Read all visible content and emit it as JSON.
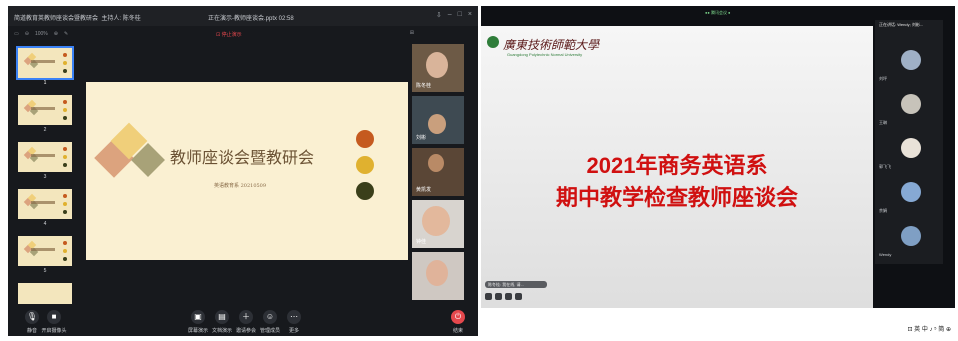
{
  "meeting": {
    "title": "简道教育英教师座谈会暨教研会",
    "host_label": "主持人: 陈冬桂",
    "presenting": "正在演示-教师座谈会.pptx 02:58",
    "stop_share": "停止演示",
    "zoom_level": "100%"
  },
  "thumbnails": [
    {
      "num": "1"
    },
    {
      "num": "2"
    },
    {
      "num": "3"
    },
    {
      "num": "4"
    },
    {
      "num": "5"
    }
  ],
  "slide": {
    "title": "教师座谈会暨教研会",
    "subtitle": "英语教育系 20210509",
    "colors": {
      "orange": "#c55a1f",
      "gold": "#e0b12f",
      "olive": "#3a3f1a",
      "tan": "#dca37e",
      "sand": "#f0cf7a",
      "khaki": "#a8a278"
    }
  },
  "participants": [
    {
      "name": "陈冬桂"
    },
    {
      "name": "刘彬"
    },
    {
      "name": "黄凯发"
    },
    {
      "name": "钟佳"
    },
    {
      "name": ""
    }
  ],
  "bottombar": {
    "mute": "静音",
    "camera": "开启摄像头",
    "share": "屏幕演示",
    "doc": "文档演示",
    "invite": "邀请参会",
    "members": "管理成员",
    "more": "更多",
    "end": "结束"
  },
  "right_window": {
    "recording": "●● 腾讯会议 ●",
    "university_cn": "廣東技術師範大學",
    "university_en": "Guangdong Polytechnic Normal University",
    "heading_line1": "2021年商务英语系",
    "heading_line2": "期中教学检查教师座谈会",
    "chat_hint": "陈冬桂: 我在线, 请...",
    "panel_header": "正在讲话: Wendy; 刘彬...",
    "panel_names": [
      "刘坪",
      "王琳",
      "郭飞飞",
      "余娟",
      "Wendy"
    ],
    "tray_text": "⊡ 英 中 ♪ ⁵ 简 ⊕"
  }
}
